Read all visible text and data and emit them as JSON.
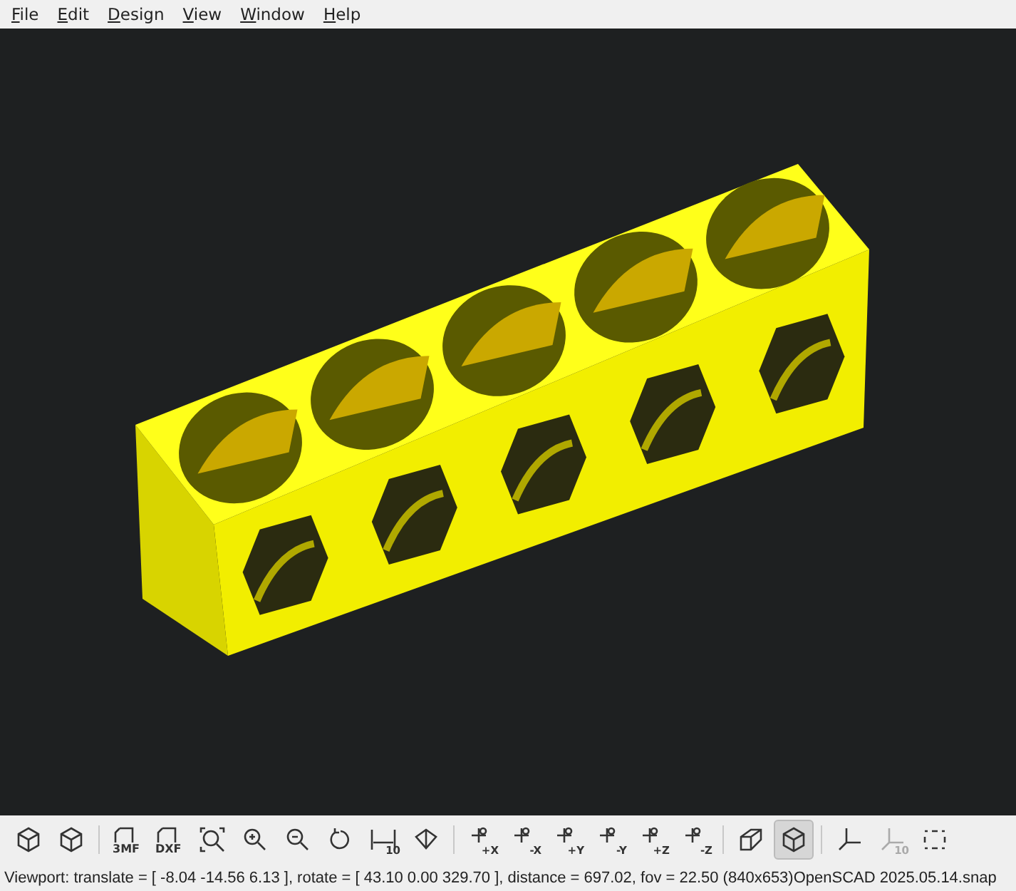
{
  "menu": [
    {
      "label": "File"
    },
    {
      "label": "Edit"
    },
    {
      "label": "Design"
    },
    {
      "label": "View"
    },
    {
      "label": "Window"
    },
    {
      "label": "Help"
    }
  ],
  "toolbar": [
    [
      {
        "kind": "preview",
        "selected": false,
        "disabled": false
      },
      {
        "kind": "render",
        "selected": false,
        "disabled": false
      }
    ],
    [
      {
        "kind": "doc",
        "label": "3MF",
        "selected": false,
        "disabled": false
      },
      {
        "kind": "doc",
        "label": "DXF",
        "selected": false,
        "disabled": false
      },
      {
        "kind": "zoom-all",
        "selected": false,
        "disabled": false
      },
      {
        "kind": "zoom-in",
        "selected": false,
        "disabled": false
      },
      {
        "kind": "zoom-out",
        "selected": false,
        "disabled": false
      },
      {
        "kind": "reset",
        "selected": false,
        "disabled": false
      },
      {
        "kind": "measure",
        "label": "10",
        "selected": false,
        "disabled": false
      },
      {
        "kind": "view-all",
        "selected": false,
        "disabled": false
      }
    ],
    [
      {
        "kind": "axis-view",
        "label": "+X",
        "selected": false,
        "disabled": false
      },
      {
        "kind": "axis-view",
        "label": "-X",
        "selected": false,
        "disabled": false
      },
      {
        "kind": "axis-view",
        "label": "+Y",
        "selected": false,
        "disabled": false
      },
      {
        "kind": "axis-view",
        "label": "-Y",
        "selected": false,
        "disabled": false
      },
      {
        "kind": "axis-view",
        "label": "+Z",
        "selected": false,
        "disabled": false
      },
      {
        "kind": "axis-view",
        "label": "-Z",
        "selected": false,
        "disabled": false
      }
    ],
    [
      {
        "kind": "perspective",
        "selected": false,
        "disabled": false
      },
      {
        "kind": "orthogonal",
        "selected": true,
        "disabled": false
      }
    ],
    [
      {
        "kind": "axes",
        "selected": false,
        "disabled": false
      },
      {
        "kind": "scale",
        "label": "10",
        "selected": false,
        "disabled": true
      },
      {
        "kind": "edges",
        "selected": false,
        "disabled": false
      }
    ]
  ],
  "status_bar": {
    "viewport": "Viewport: translate = [ -8.04 -14.56 6.13 ], rotate = [ 43.10 0.00 329.70 ], distance = 697.02, fov = 22.50 (840x653)",
    "version": "OpenSCAD 2025.05.14.snap"
  }
}
